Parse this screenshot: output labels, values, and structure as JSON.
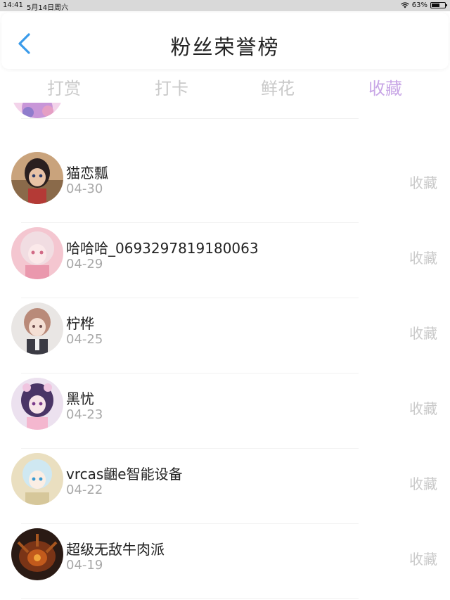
{
  "status_bar": {
    "time": "14:41",
    "date": "5月14日周六",
    "battery_text": "63%",
    "battery_level": 0.63
  },
  "header": {
    "title": "粉丝荣誉榜",
    "back_icon": "chevron-left-icon",
    "accent_color": "#3a9bea"
  },
  "tabs": [
    {
      "label": "打赏",
      "active": false
    },
    {
      "label": "打卡",
      "active": false
    },
    {
      "label": "鲜花",
      "active": false
    },
    {
      "label": "收藏",
      "active": true
    }
  ],
  "active_tab_color": "#c8a6e6",
  "fans": [
    {
      "name": "猫恋瓢",
      "date": "04-30",
      "action": "收藏"
    },
    {
      "name": "哈哈哈_0693297819180063",
      "date": "04-29",
      "action": "收藏"
    },
    {
      "name": "柠桦",
      "date": "04-25",
      "action": "收藏"
    },
    {
      "name": "黑忧",
      "date": "04-23",
      "action": "收藏"
    },
    {
      "name": "vrcas齫e智能设备",
      "date": "04-22",
      "action": "收藏"
    },
    {
      "name": "超级无敌牛肉派",
      "date": "04-19",
      "action": "收藏"
    }
  ]
}
